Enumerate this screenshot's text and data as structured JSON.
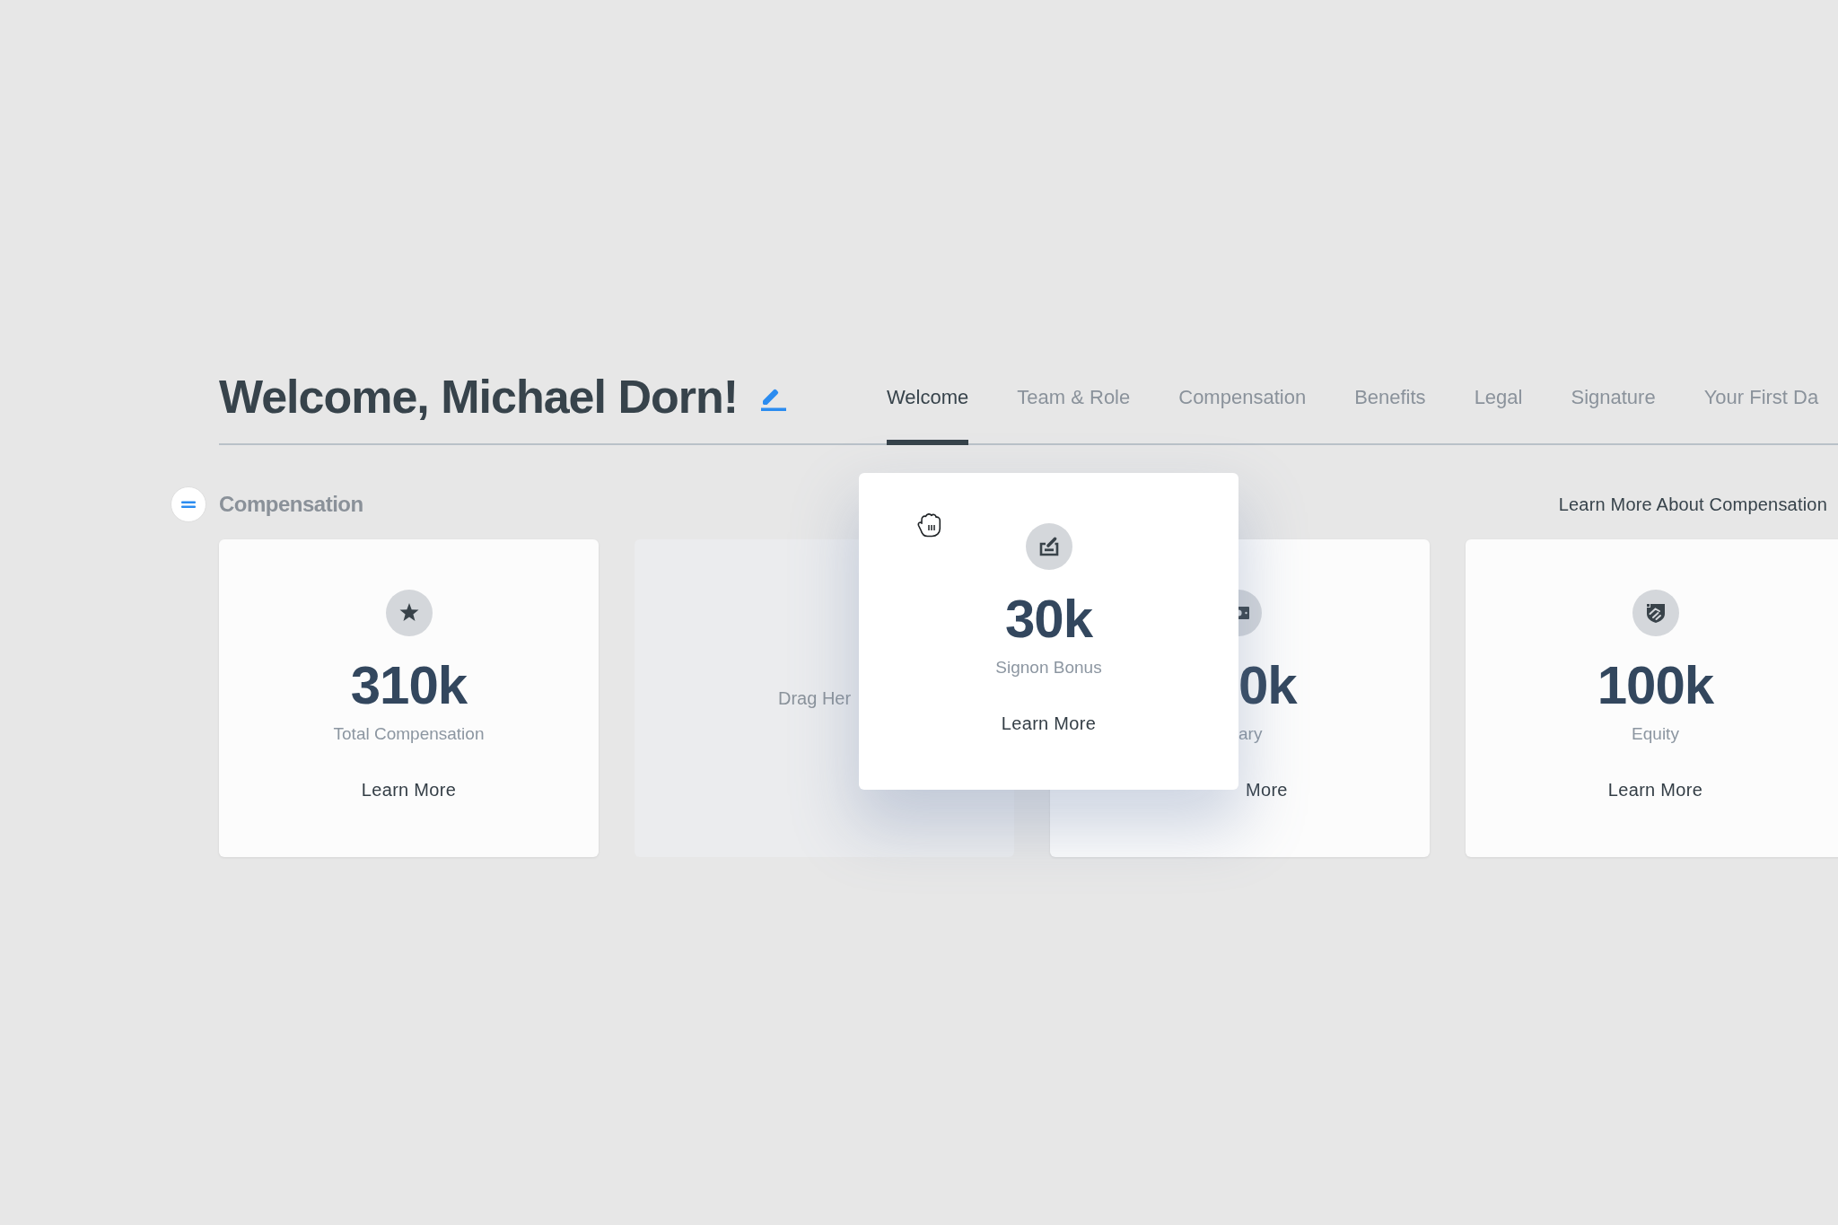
{
  "header": {
    "title": "Welcome, Michael Dorn!"
  },
  "tabs": [
    {
      "label": "Welcome",
      "selected": true
    },
    {
      "label": "Team & Role",
      "selected": false
    },
    {
      "label": "Compensation",
      "selected": false
    },
    {
      "label": "Benefits",
      "selected": false
    },
    {
      "label": "Legal",
      "selected": false
    },
    {
      "label": "Signature",
      "selected": false
    },
    {
      "label": "Your First Da",
      "selected": false
    }
  ],
  "section": {
    "title": "Compensation",
    "link": "Learn More About Compensation"
  },
  "cards": [
    {
      "kind": "stat",
      "value": "310k",
      "label": "Total Compensation",
      "link": "Learn More"
    },
    {
      "kind": "drop_zone",
      "text": "Drag Her"
    },
    {
      "kind": "covered",
      "value": "0k",
      "label": "ary",
      "link": "More"
    },
    {
      "kind": "stat",
      "value": "100k",
      "label": "Equity",
      "link": "Learn More"
    }
  ],
  "dragged_card": {
    "value": "30k",
    "label": "Signon Bonus",
    "link": "Learn More"
  }
}
